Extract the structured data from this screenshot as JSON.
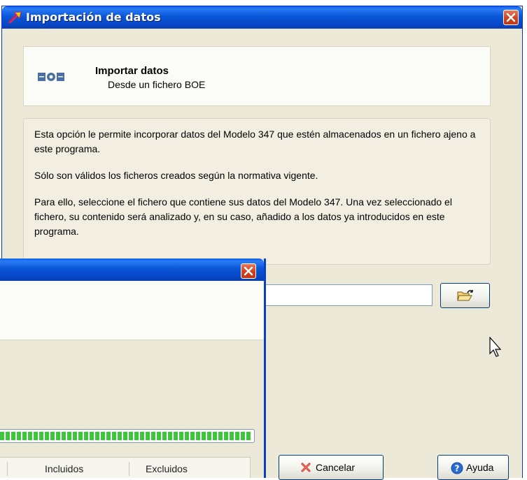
{
  "main_window": {
    "title": "Importación de datos",
    "header": {
      "title": "Importar datos",
      "subtitle": "Desde un fichero BOE"
    },
    "description": [
      "Esta opción le permite incorporar datos del Modelo 347 que estén almacenados en un fichero ajeno a este programa.",
      "Sólo son válidos los ficheros creados según la normativa vigente.",
      "Para ello, seleccione el fichero que contiene sus datos del Modelo 347. Una vez seleccionado el fichero, su contenido será analizado y, en su caso, añadido a los datos ya introducidos en este programa."
    ],
    "file_input": {
      "value": ""
    },
    "buttons": {
      "cancel": "Cancelar",
      "help": "Ayuda"
    }
  },
  "progress_window": {
    "progress_fraction": 1.0,
    "columns": [
      "Incluidos",
      "Excluidos"
    ]
  },
  "colors": {
    "titlebar": "#0a56d8",
    "close_button": "#d0411e",
    "window_bg": "#ece9d8",
    "progress_green": "#3ec43e"
  },
  "icons": [
    "app-arrow-icon",
    "close-icon",
    "boe-logo",
    "open-folder-icon",
    "cancel-x-icon",
    "help-icon",
    "mouse-cursor-icon"
  ]
}
